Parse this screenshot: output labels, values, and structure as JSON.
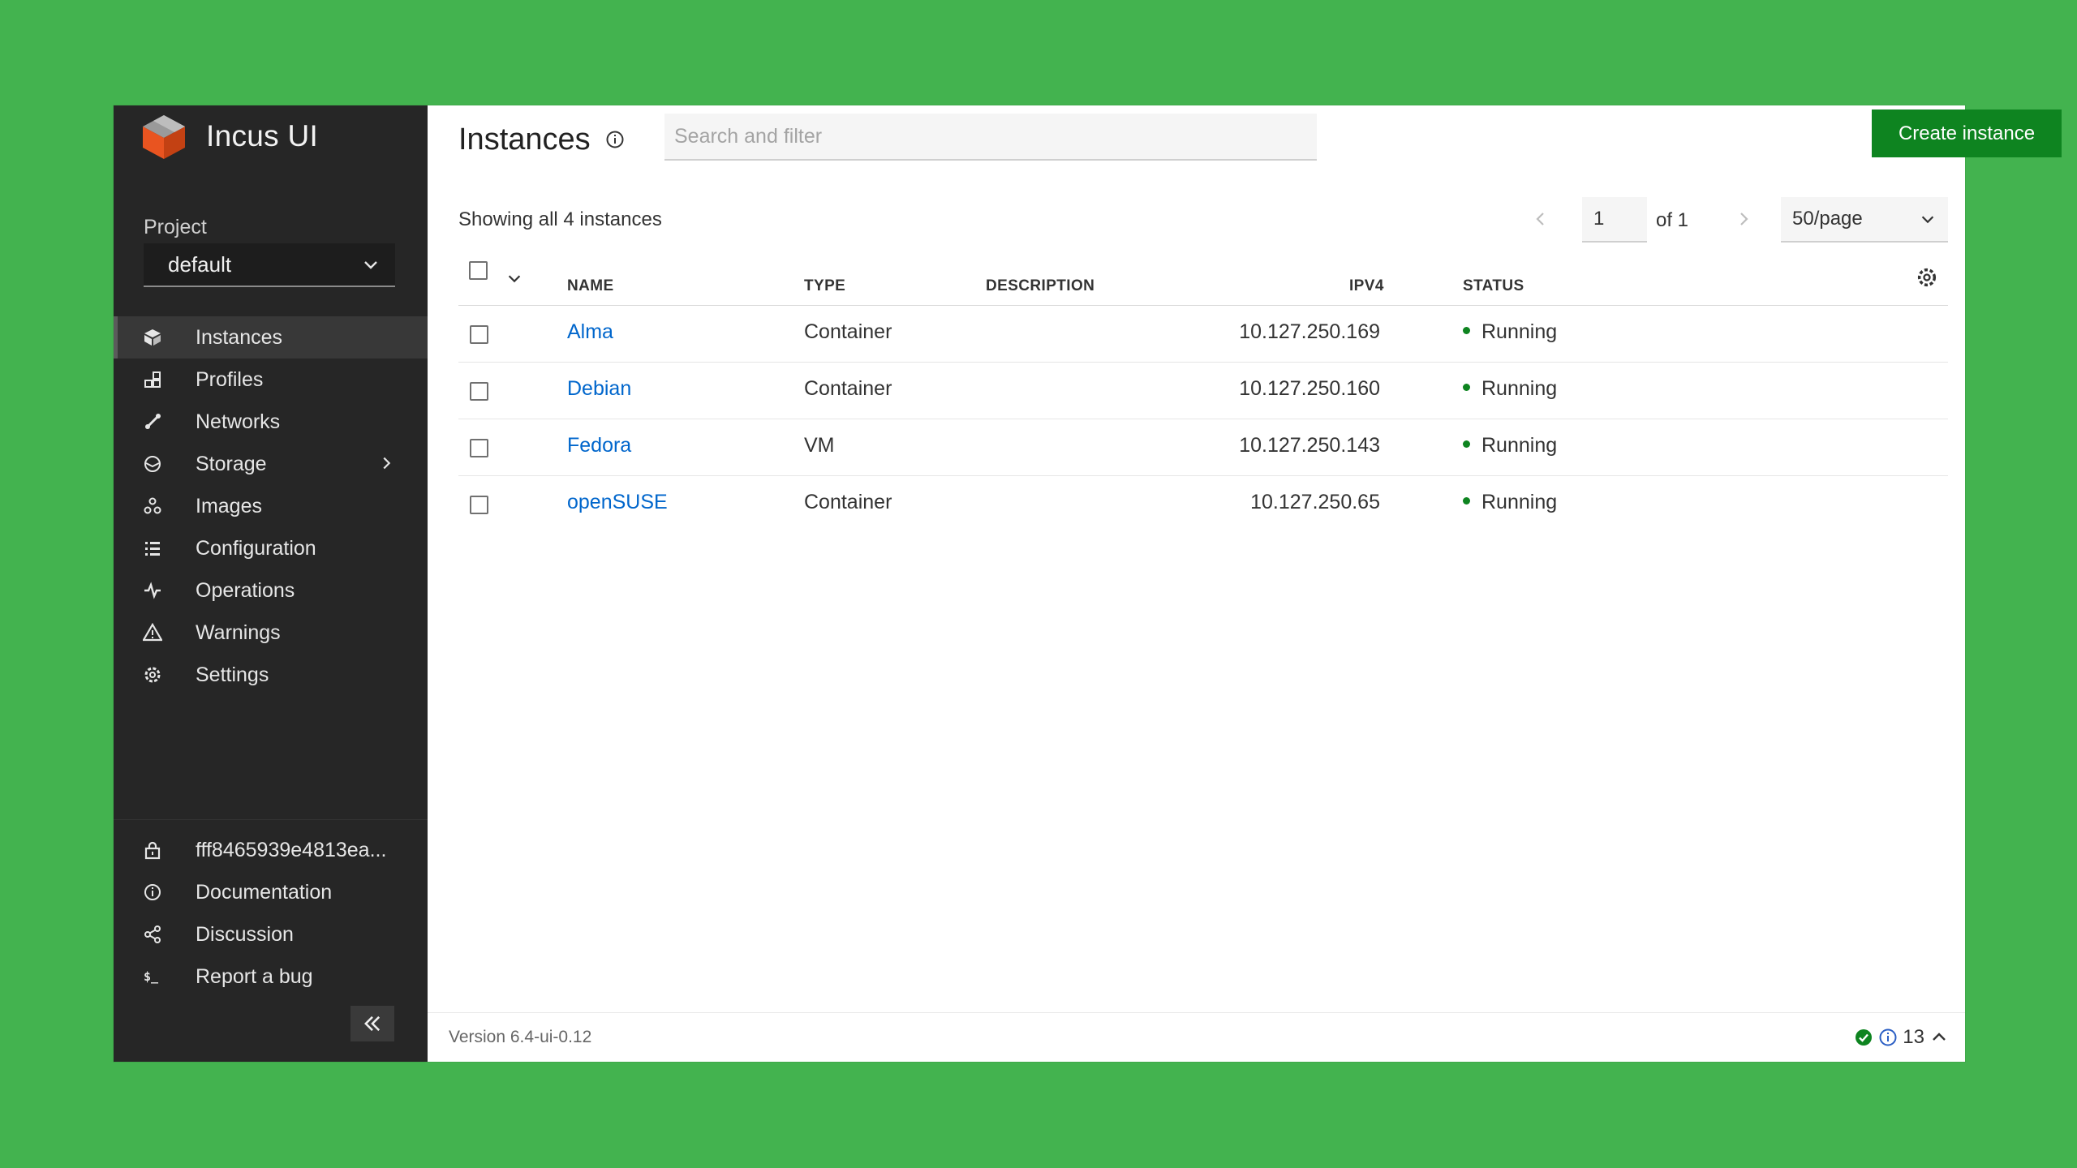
{
  "brand": {
    "name": "Incus UI",
    "logo_icon": "incus-logo-icon"
  },
  "project": {
    "label": "Project",
    "selected": "default"
  },
  "sidebar": {
    "items": [
      {
        "label": "Instances",
        "icon": "instances-icon",
        "active": true
      },
      {
        "label": "Profiles",
        "icon": "profiles-icon"
      },
      {
        "label": "Networks",
        "icon": "networks-icon"
      },
      {
        "label": "Storage",
        "icon": "storage-icon",
        "has_submenu": true
      },
      {
        "label": "Images",
        "icon": "images-icon"
      },
      {
        "label": "Configuration",
        "icon": "configuration-icon"
      },
      {
        "label": "Operations",
        "icon": "operations-icon"
      },
      {
        "label": "Warnings",
        "icon": "warning-icon"
      },
      {
        "label": "Settings",
        "icon": "settings-icon"
      }
    ],
    "bottom": [
      {
        "label": "fff8465939e4813ea...",
        "icon": "lock-icon"
      },
      {
        "label": "Documentation",
        "icon": "info-icon"
      },
      {
        "label": "Discussion",
        "icon": "share-icon"
      },
      {
        "label": "Report a bug",
        "icon": "terminal-icon"
      }
    ],
    "collapse_label": "«"
  },
  "main": {
    "title": "Instances",
    "search_placeholder": "Search and filter",
    "create_button": "Create instance",
    "showing": "Showing all 4 instances",
    "pagination": {
      "current": "1",
      "of_label": "of 1",
      "per_page": "50/page"
    }
  },
  "table": {
    "headers": {
      "name": "NAME",
      "type": "TYPE",
      "description": "DESCRIPTION",
      "ipv4": "IPV4",
      "status": "STATUS"
    },
    "rows": [
      {
        "name": "Alma",
        "type": "Container",
        "description": "",
        "ipv4": "10.127.250.169",
        "status": "Running"
      },
      {
        "name": "Debian",
        "type": "Container",
        "description": "",
        "ipv4": "10.127.250.160",
        "status": "Running"
      },
      {
        "name": "Fedora",
        "type": "VM",
        "description": "",
        "ipv4": "10.127.250.143",
        "status": "Running"
      },
      {
        "name": "openSUSE",
        "type": "Container",
        "description": "",
        "ipv4": "10.127.250.65",
        "status": "Running"
      }
    ]
  },
  "footer": {
    "version": "Version 6.4-ui-0.12",
    "count": "13"
  },
  "colors": {
    "background": "#43b34f",
    "sidebar": "#262626",
    "accent": "#0e8420",
    "link": "#0066cc"
  }
}
